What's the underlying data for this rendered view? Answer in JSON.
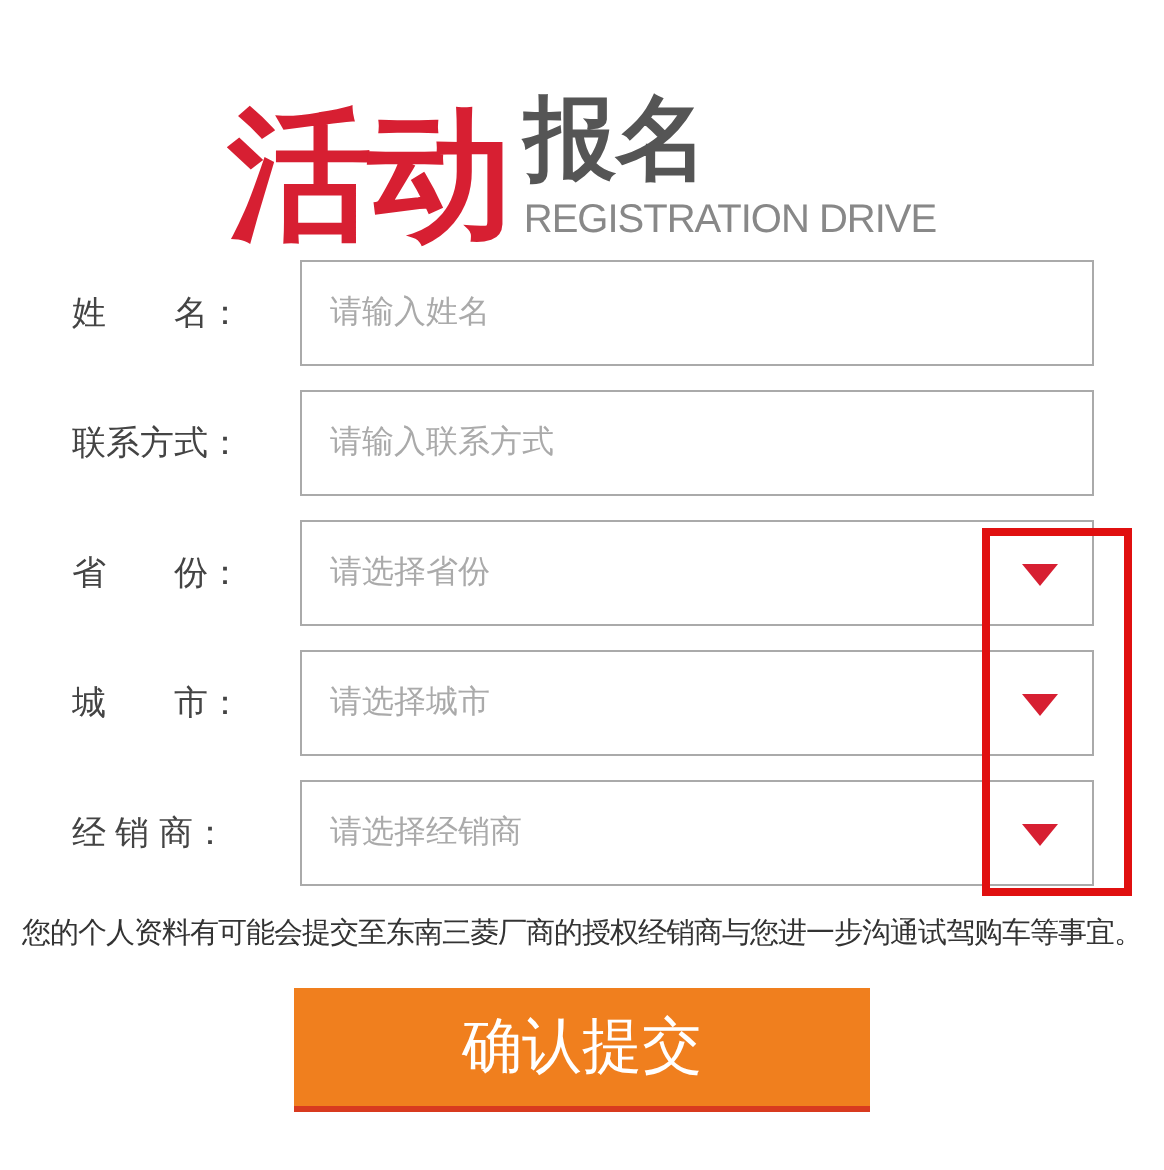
{
  "heading": {
    "main": "活动",
    "sub": "报名",
    "english": "REGISTRATION DRIVE"
  },
  "fields": [
    {
      "label": "姓　　名：",
      "placeholder": "请输入姓名",
      "kind": "text"
    },
    {
      "label": "联系方式：",
      "placeholder": "请输入联系方式",
      "kind": "text"
    },
    {
      "label": "省　　份：",
      "placeholder": "请选择省份",
      "kind": "select"
    },
    {
      "label": "城　　市：",
      "placeholder": "请选择城市",
      "kind": "select"
    },
    {
      "label": "经 销 商：",
      "placeholder": "请选择经销商",
      "kind": "select"
    }
  ],
  "arrow_highlight": true,
  "notice": "您的个人资料有可能会提交至东南三菱厂商的授权经销商与您进一步沟通试驾购车等事宜。",
  "submit_button": "确认提交"
}
